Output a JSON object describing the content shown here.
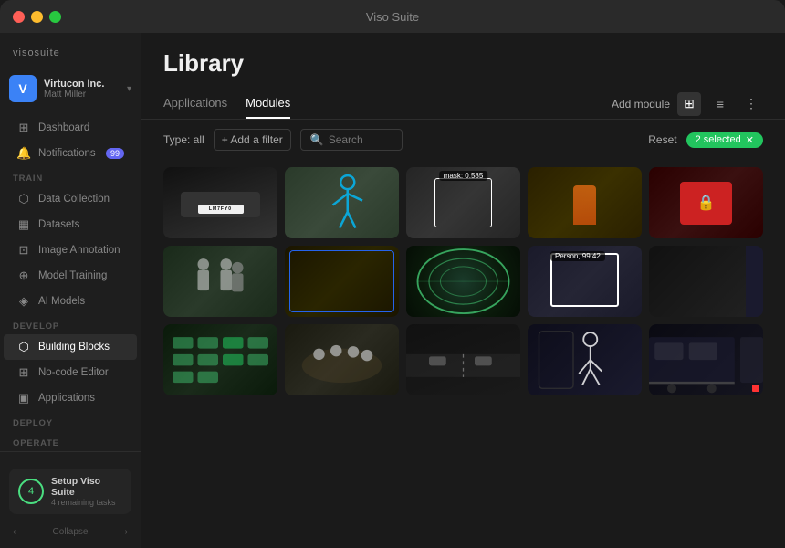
{
  "window": {
    "title": "Viso Suite"
  },
  "titlebar": {
    "dots": [
      "red",
      "yellow",
      "green"
    ]
  },
  "sidebar": {
    "logo": "visosuite",
    "account": {
      "initial": "V",
      "company": "Virtucon Inc.",
      "user": "Matt Miller"
    },
    "nav": [
      {
        "id": "dashboard",
        "label": "Dashboard",
        "icon": "⊞",
        "active": false
      },
      {
        "id": "notifications",
        "label": "Notifications",
        "icon": "🔔",
        "badge": "99",
        "active": false
      }
    ],
    "sections": [
      {
        "label": "TRAIN",
        "items": [
          {
            "id": "data-collection",
            "label": "Data Collection",
            "icon": "⬡",
            "active": false
          },
          {
            "id": "datasets",
            "label": "Datasets",
            "icon": "▦",
            "active": false
          },
          {
            "id": "image-annotation",
            "label": "Image Annotation",
            "icon": "⊡",
            "active": false
          },
          {
            "id": "model-training",
            "label": "Model Training",
            "icon": "⊕",
            "active": false
          },
          {
            "id": "ai-models",
            "label": "AI Models",
            "icon": "◈",
            "active": false
          }
        ]
      },
      {
        "label": "DEVELOP",
        "items": [
          {
            "id": "building-blocks",
            "label": "Building Blocks",
            "icon": "⬡",
            "active": true
          },
          {
            "id": "no-code-editor",
            "label": "No-code Editor",
            "icon": "⊞",
            "active": false
          },
          {
            "id": "applications",
            "label": "Applications",
            "icon": "▣",
            "active": false
          }
        ]
      },
      {
        "label": "DEPLOY",
        "items": []
      },
      {
        "label": "OPERATE",
        "items": []
      }
    ],
    "setup": {
      "progress": "4",
      "title": "Setup Viso Suite",
      "subtitle": "4 remaining tasks"
    },
    "collapse_label": "Collapse"
  },
  "main": {
    "title": "Library",
    "tabs": [
      {
        "id": "applications",
        "label": "Applications",
        "active": false
      },
      {
        "id": "modules",
        "label": "Modules",
        "active": true
      }
    ],
    "toolbar": {
      "add_module": "Add module",
      "grid_icon": "⊞",
      "list_icon": "≡",
      "more_icon": "⋮"
    },
    "filters": {
      "type_label": "Type: all",
      "add_filter": "+ Add a filter",
      "search_placeholder": "Search",
      "reset": "Reset",
      "selected": "2 selected"
    },
    "grid_items": [
      {
        "id": 1,
        "type": "car",
        "label": ""
      },
      {
        "id": 2,
        "type": "skeleton",
        "label": ""
      },
      {
        "id": 3,
        "type": "person-box",
        "label": "mask: 0.585"
      },
      {
        "id": 4,
        "type": "worker-orange",
        "label": ""
      },
      {
        "id": 5,
        "type": "lock-sign",
        "label": ""
      },
      {
        "id": 6,
        "type": "people-group",
        "label": ""
      },
      {
        "id": 7,
        "type": "construction",
        "label": ""
      },
      {
        "id": 8,
        "type": "tunnel",
        "label": ""
      },
      {
        "id": 9,
        "type": "person-detect",
        "label": "Person, 99.42"
      },
      {
        "id": 10,
        "type": "train-partial",
        "label": ""
      },
      {
        "id": 11,
        "type": "parking",
        "label": ""
      },
      {
        "id": 12,
        "type": "meeting",
        "label": ""
      },
      {
        "id": 13,
        "type": "highway",
        "label": ""
      },
      {
        "id": 14,
        "type": "person-walk",
        "label": ""
      },
      {
        "id": 15,
        "type": "train-station",
        "label": ""
      }
    ]
  }
}
